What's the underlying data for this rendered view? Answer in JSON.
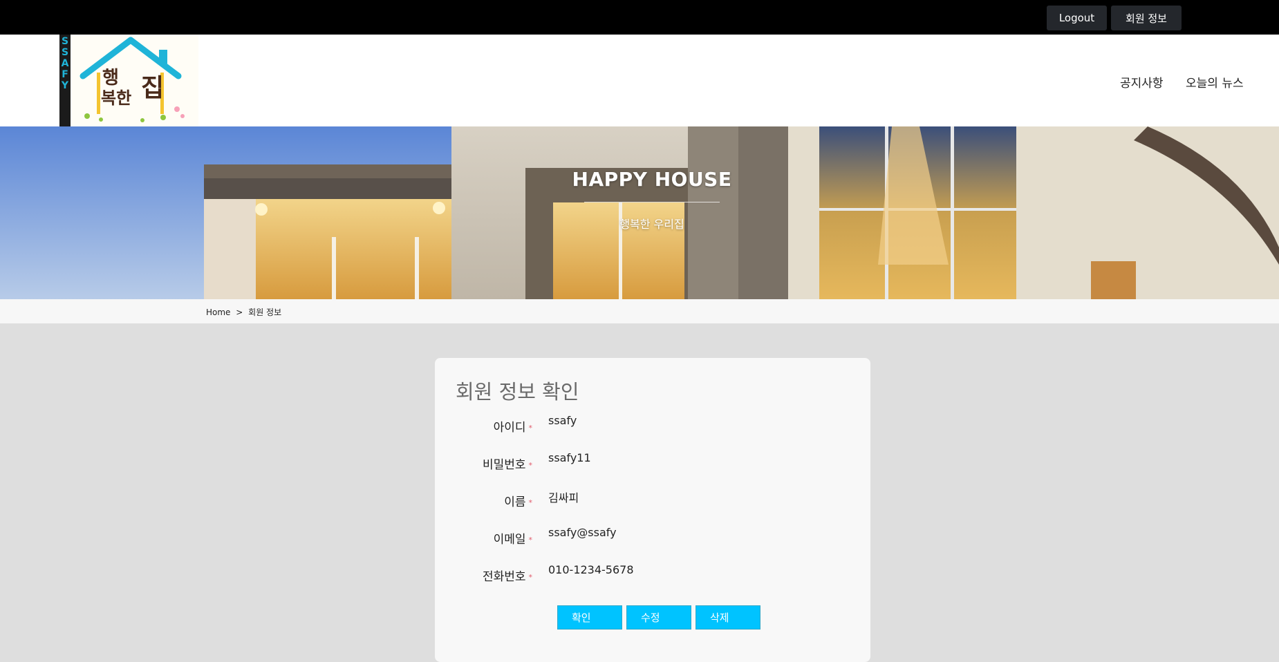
{
  "topbar": {
    "logout_label": "Logout",
    "member_info_label": "회원 정보"
  },
  "header": {
    "logo_side_text": "SSAFY",
    "logo_text_1": "행",
    "logo_text_2": "복한",
    "logo_text_3": "집",
    "nav": [
      {
        "label": "공지사항"
      },
      {
        "label": "오늘의 뉴스"
      }
    ]
  },
  "hero": {
    "title": "HAPPY HOUSE",
    "subtitle": "행복한 우리집"
  },
  "breadcrumb": {
    "home": "Home",
    "separator": ">",
    "current": "회원 정보"
  },
  "card": {
    "title": "회원 정보 확인",
    "required_mark": "*",
    "fields": [
      {
        "label": "아이디",
        "value": "ssafy"
      },
      {
        "label": "비밀번호",
        "value": "ssafy11"
      },
      {
        "label": "이름",
        "value": "김싸피"
      },
      {
        "label": "이메일",
        "value": "ssafy@ssafy"
      },
      {
        "label": "전화번호",
        "value": "010-1234-5678"
      }
    ],
    "buttons": {
      "confirm": "확인",
      "edit": "수정",
      "delete": "삭제"
    }
  },
  "colors": {
    "accent_button": "#00c3ff",
    "topbar": "#000000",
    "page_bg": "#dedede"
  }
}
